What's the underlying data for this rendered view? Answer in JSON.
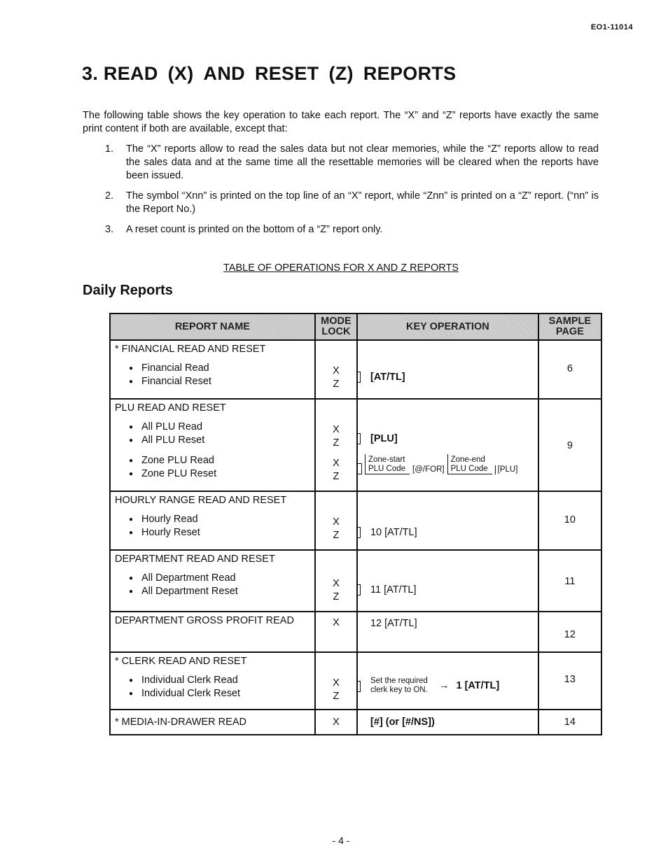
{
  "doc_id": "EO1-11014",
  "title_parts": [
    "3. READ",
    "(X)",
    "AND",
    "RESET",
    "(Z)",
    "REPORTS"
  ],
  "intro": "The following table shows the key operation to take each report.   The “X” and “Z” reports have exactly the same print content if both are available, except that:",
  "list": [
    {
      "n": "1.",
      "text": "The “X” reports allow to read the sales data but not clear memories, while the “Z” reports allow to read the sales data and at the same time all the resettable memories will be cleared when the reports have been issued."
    },
    {
      "n": "2.",
      "text": "The symbol “Xnn” is printed on the top line of an “X” report, while “Znn” is printed on a “Z” report.   (“nn” is the Report No.)"
    },
    {
      "n": "3.",
      "text": "A reset count is printed on the bottom of a “Z” report only."
    }
  ],
  "caption": "TABLE OF OPERATIONS FOR X AND Z REPORTS",
  "section": "Daily Reports",
  "table": {
    "headers": [
      "REPORT NAME",
      "MODE LOCK",
      "KEY OPERATION",
      "SAMPLE PAGE"
    ],
    "rows": [
      {
        "group": "* FINANCIAL READ AND RESET",
        "items": [
          "Financial Read",
          "Financial Reset"
        ],
        "modes": [
          "X",
          "Z"
        ],
        "key": "[AT/TL]",
        "page": "6"
      },
      {
        "group": "PLU READ AND RESET",
        "items": [
          "All PLU Read",
          "All PLU Reset",
          "Zone PLU Read",
          "Zone PLU Reset"
        ],
        "modes": [
          "X",
          "Z",
          "X",
          "Z"
        ],
        "key": "[PLU]",
        "zone": {
          "start": "Zone-start",
          "code": "PLU Code",
          "for": "[@/FOR]",
          "end": "Zone-end",
          "plu": "[PLU]"
        },
        "page": "9"
      },
      {
        "group": "HOURLY RANGE READ AND RESET",
        "items": [
          "Hourly Read",
          "Hourly Reset"
        ],
        "modes": [
          "X",
          "Z"
        ],
        "key": "10 [AT/TL]",
        "page": "10"
      },
      {
        "group": "DEPARTMENT READ AND RESET",
        "items": [
          "All Department Read",
          "All Department Reset"
        ],
        "modes": [
          "X",
          "Z"
        ],
        "key": "11 [AT/TL]",
        "page": "11"
      },
      {
        "group": "DEPARTMENT GROSS PROFIT READ",
        "items": [],
        "modes": [
          "X"
        ],
        "key": "12 [AT/TL]",
        "page": "12"
      },
      {
        "group": "* CLERK READ AND RESET",
        "items": [
          "Individual Clerk Read",
          "Individual Clerk Reset"
        ],
        "modes": [
          "X",
          "Z"
        ],
        "key_note": "Set the required clerk key to  ON.",
        "arrow": "→",
        "key": "1 [AT/TL]",
        "page": "13"
      },
      {
        "group": "* MEDIA-IN-DRAWER READ",
        "items": [],
        "modes": [
          "X"
        ],
        "key": "[#] (or [#/NS])",
        "page": "14"
      }
    ]
  },
  "footer": "- 4 -"
}
